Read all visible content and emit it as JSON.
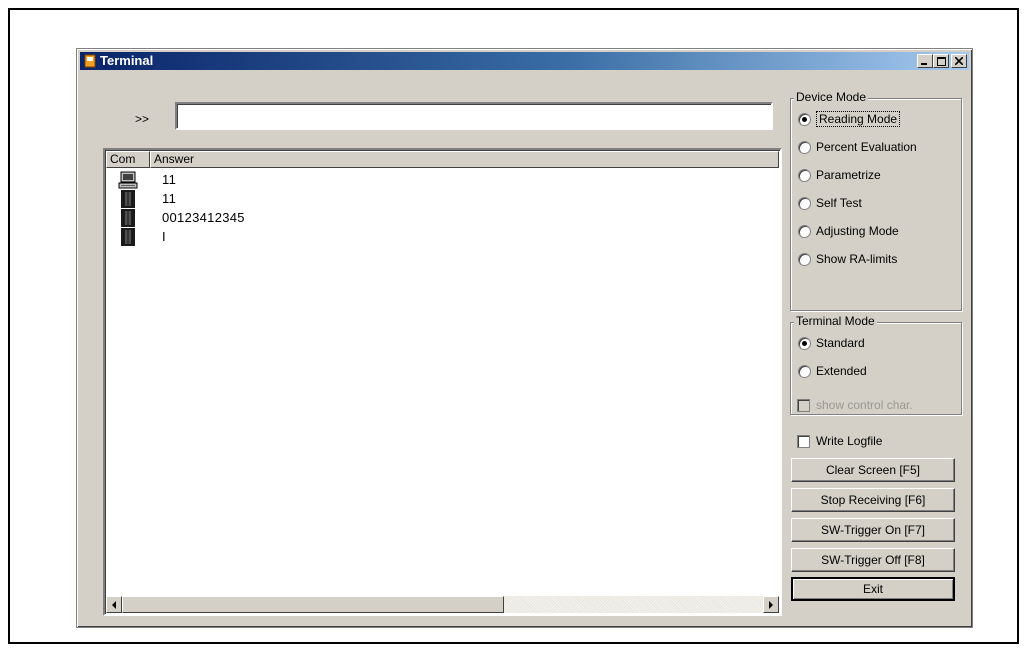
{
  "window": {
    "title": "Terminal"
  },
  "command": {
    "prompt": ">>",
    "value": ""
  },
  "table": {
    "columns": [
      "Com",
      "Answer"
    ],
    "rows": [
      {
        "icon": "computer-icon",
        "value": "11"
      },
      {
        "icon": "device-icon",
        "value": "11"
      },
      {
        "icon": "device-icon",
        "value": "00123412345"
      },
      {
        "icon": "device-icon",
        "value": "I"
      }
    ]
  },
  "device_mode": {
    "title": "Device Mode",
    "options": [
      "Reading Mode",
      "Percent Evaluation",
      "Parametrize",
      "Self Test",
      "Adjusting Mode",
      "Show RA-limits"
    ],
    "selected": "Reading Mode"
  },
  "terminal_mode": {
    "title": "Terminal Mode",
    "options": [
      "Standard",
      "Extended"
    ],
    "selected": "Standard",
    "show_control_char": "show control char."
  },
  "write_logfile": "Write Logfile",
  "buttons": {
    "clear": "Clear Screen [F5]",
    "stop": "Stop Receiving [F6]",
    "trigger_on": "SW-Trigger On [F7]",
    "trigger_off": "SW-Trigger Off [F8]",
    "exit": "Exit"
  },
  "colors": {
    "titlebar_start": "#0a246a",
    "titlebar_end": "#a6caf0",
    "face": "#d4d0c8"
  }
}
